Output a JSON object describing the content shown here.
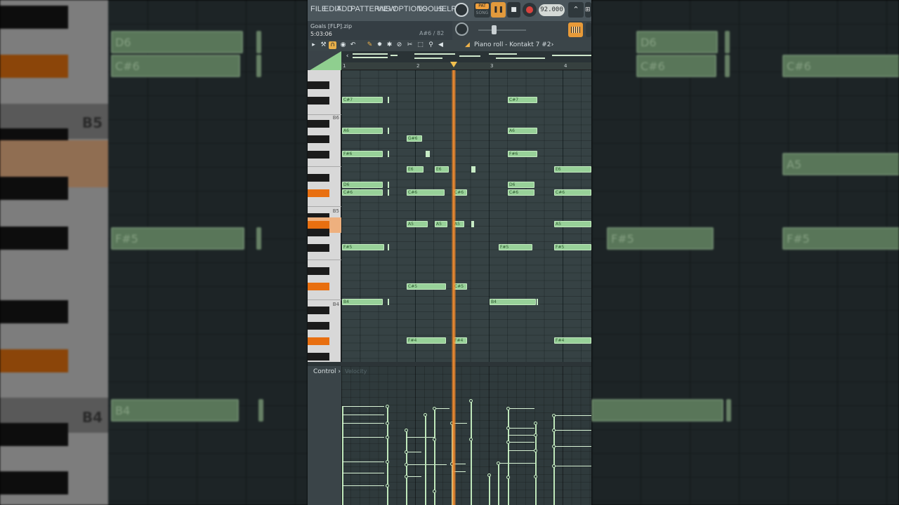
{
  "menu": {
    "items": [
      "FILE",
      "EDIT",
      "ADD",
      "PATTERNS",
      "VIEW",
      "OPTIONS",
      "TOOLS",
      "HELP"
    ]
  },
  "transport": {
    "pat_label": "PAT",
    "song_label": "SONG",
    "tempo": "92.000"
  },
  "song": {
    "file_name": "Goals [FLP].zip",
    "time": "5:03:06",
    "hint": "A#6 / 82"
  },
  "piano_roll": {
    "title": "Piano roll - Kontakt 7 #2",
    "bar_numbers": [
      "1",
      "2",
      "3",
      "4"
    ],
    "octave_labels": [
      "B6",
      "B5",
      "B4"
    ]
  },
  "notes": [
    {
      "pitch": "C#7"
    },
    {
      "pitch": "A6"
    },
    {
      "pitch": "G#6"
    },
    {
      "pitch": "F#6"
    },
    {
      "pitch": "E6"
    },
    {
      "pitch": "D6"
    },
    {
      "pitch": "C#6"
    },
    {
      "pitch": "A5"
    },
    {
      "pitch": "F#5"
    },
    {
      "pitch": "C#5"
    },
    {
      "pitch": "B4"
    },
    {
      "pitch": "F#4"
    }
  ],
  "control": {
    "label": "Control",
    "target": "Velocity"
  },
  "backdrop": {
    "labels": [
      "D6",
      "C#6",
      "B5",
      "A5",
      "F#5",
      "B4"
    ]
  },
  "colors": {
    "note_fill": "#98d199",
    "playhead": "#f08a2e",
    "key_highlight": "#e86f10"
  }
}
